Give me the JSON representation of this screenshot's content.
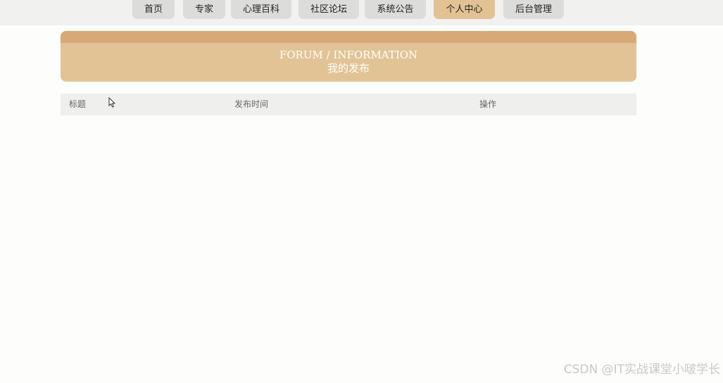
{
  "nav": {
    "items": [
      {
        "label": "首页",
        "active": false
      },
      {
        "label": "专家",
        "active": false
      },
      {
        "label": "心理百科",
        "active": false
      },
      {
        "label": "社区论坛",
        "active": false
      },
      {
        "label": "系统公告",
        "active": false
      },
      {
        "label": "个人中心",
        "active": true
      },
      {
        "label": "后台管理",
        "active": false
      }
    ]
  },
  "banner": {
    "english": "FORUM / INFORMATION",
    "title": "我的发布"
  },
  "table": {
    "columns": [
      "标题",
      "发布时间",
      "操作"
    ],
    "rows": []
  },
  "watermark": "CSDN @IT实战课堂小啵学长",
  "colors": {
    "accent": "#e2c395",
    "accent_dark": "#d7a977",
    "nav_inactive": "#dcdcdb"
  }
}
